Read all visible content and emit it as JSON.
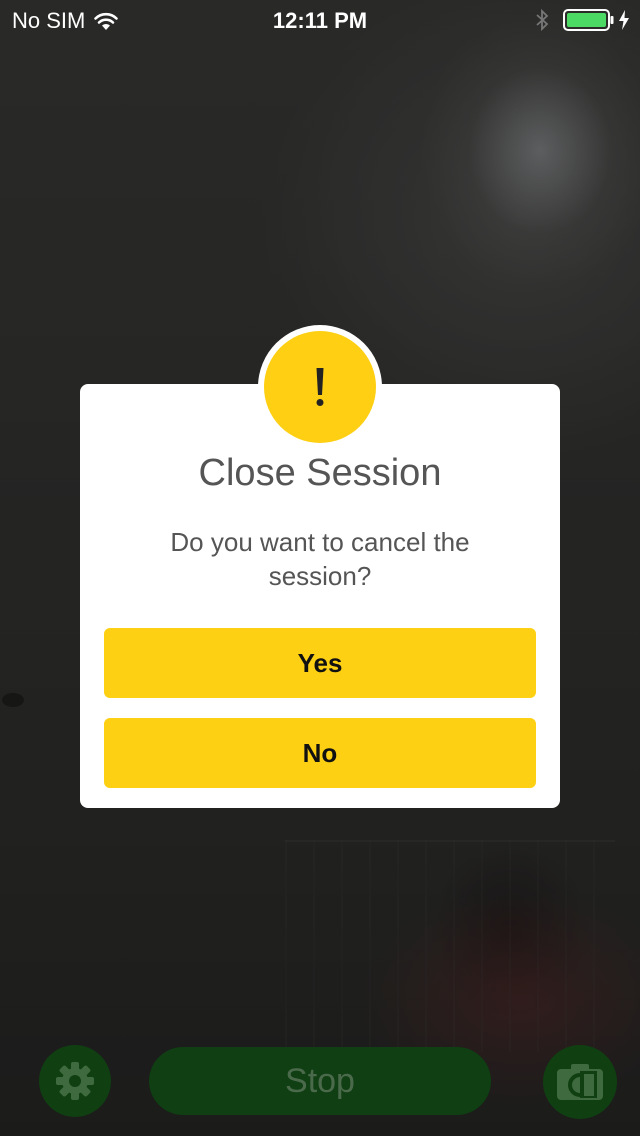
{
  "status_bar": {
    "carrier": "No SIM",
    "time": "12:11 PM",
    "battery_color": "#4cd964"
  },
  "dialog": {
    "title": "Close Session",
    "message": "Do you want to cancel the session?",
    "yes_label": "Yes",
    "no_label": "No",
    "badge_icon": "exclamation-icon",
    "badge_color": "#fecf12",
    "button_color": "#fed013"
  },
  "controls": {
    "stop_label": "Stop",
    "settings_icon": "gear-icon",
    "camera_icon": "camera-switch-icon",
    "control_color": "#103f12"
  }
}
